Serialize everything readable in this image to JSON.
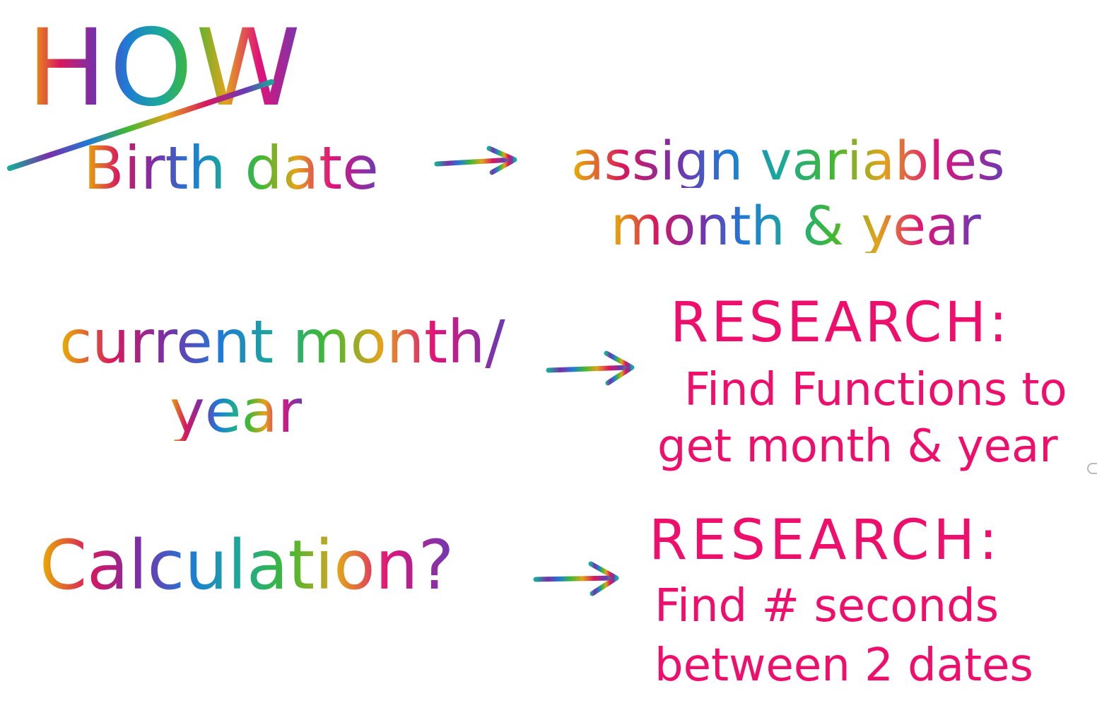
{
  "heading": "HOW",
  "rows": [
    {
      "left": [
        "Birth date"
      ],
      "right": [
        "assign variables",
        "month & year"
      ]
    },
    {
      "left": [
        "current month/",
        "year"
      ],
      "right": [
        "RESEARCH:",
        "Find Functions to",
        "get month & year"
      ]
    },
    {
      "left": [
        "Calculation?"
      ],
      "right": [
        "RESEARCH:",
        "Find # seconds",
        "between 2 dates"
      ]
    }
  ],
  "colors": {
    "pink_ink": "#ee0f6c",
    "rainbow": [
      "#e8b400",
      "#d8185e",
      "#7a2ea8",
      "#1f7ad6",
      "#1aa89a",
      "#41b832",
      "#e2a31b"
    ]
  }
}
